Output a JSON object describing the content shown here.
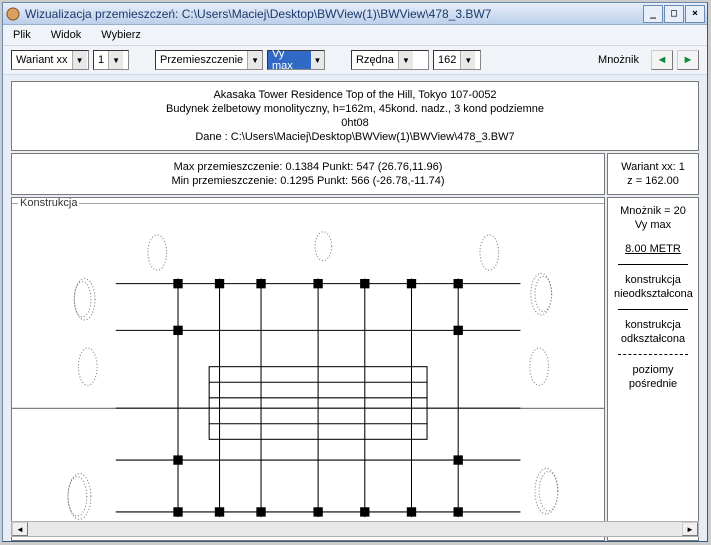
{
  "window": {
    "title": "Wizualizacja przemieszczeń: C:\\Users\\Maciej\\Desktop\\BWView(1)\\BWView\\478_3.BW7"
  },
  "menu": {
    "file": "Plik",
    "view": "Widok",
    "select": "Wybierz"
  },
  "toolbar": {
    "wariant": "Wariant xx",
    "num": "1",
    "przem": "Przemieszczenie",
    "vymax": "Vy max",
    "rzedna": "Rzędna",
    "rzedna_val": "162",
    "mnoznik_label": "Mnożnik"
  },
  "header": {
    "line1": "Akasaka Tower Residence Top of the Hill, Tokyo 107-0052",
    "line2": "Budynek żelbetowy monolityczny, h=162m, 45kond. nadz., 3 kond podziemne",
    "line3": "0ht08",
    "line4": "Dane :  C:\\Users\\Maciej\\Desktop\\BWView(1)\\BWView\\478_3.BW7"
  },
  "stats": {
    "max": "Max przemieszczenie: 0.1384    Punkt: 547 (26.76,11.96)",
    "min": "Min przemieszczenie: 0.1295    Punkt: 566 (-26.78,-11.74)"
  },
  "side_top": {
    "wariant": "Wariant xx: 1",
    "z": "z = 162.00"
  },
  "legend": {
    "mnoznik": "Mnożnik = 20",
    "vy": "Vy max",
    "scale": "8.00  METR",
    "l1a": "konstrukcja",
    "l1b": "nieodkształcona",
    "l2a": "konstrukcja",
    "l2b": "odkształcona",
    "l3a": "poziomy",
    "l3b": "pośrednie"
  },
  "fieldset_label": "Konstrukcja"
}
